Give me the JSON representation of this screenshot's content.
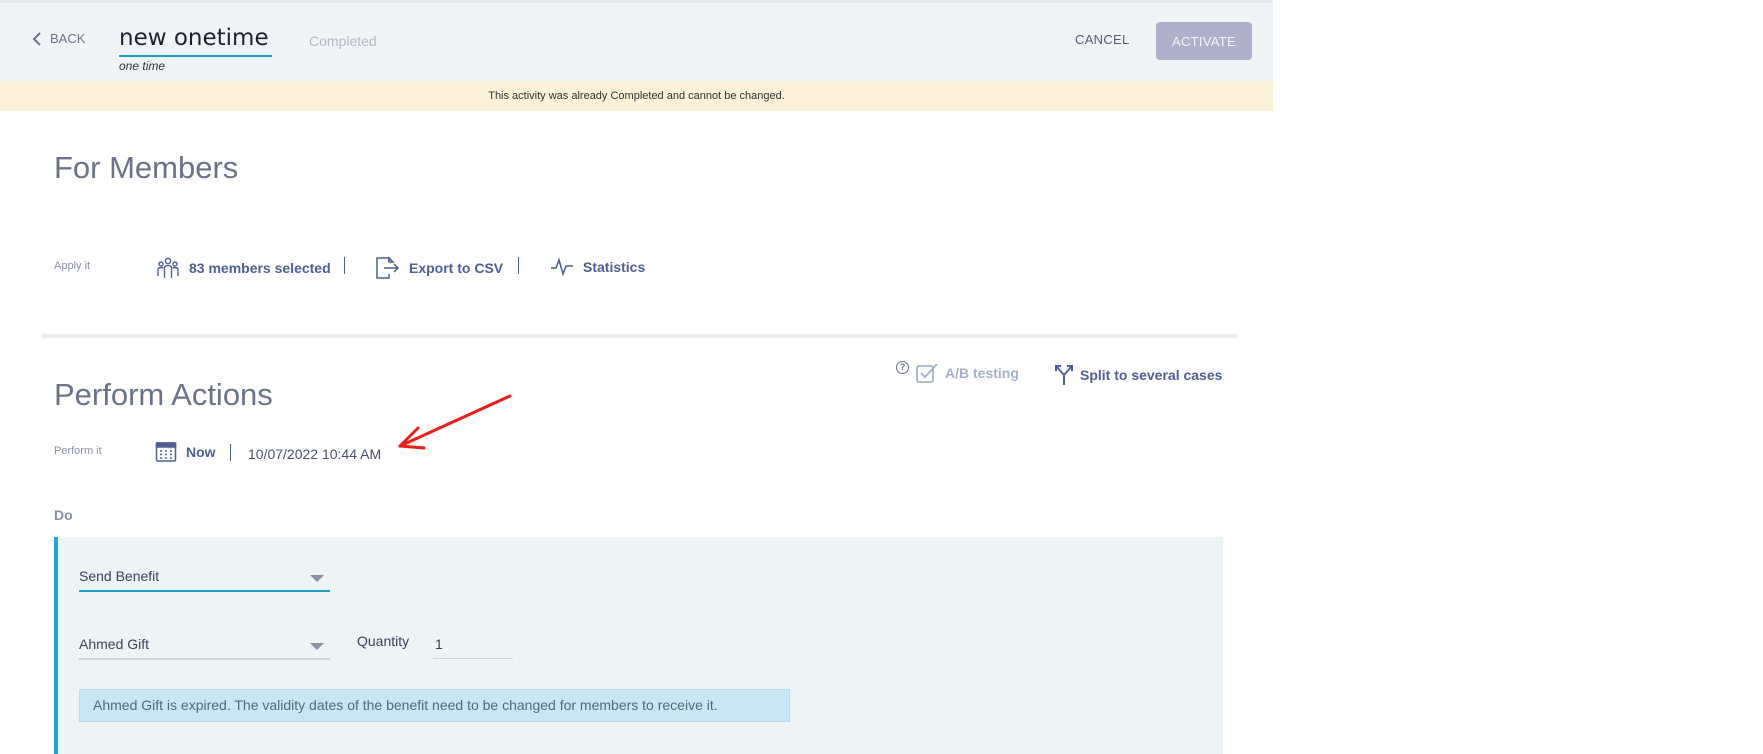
{
  "header": {
    "back_label": "BACK",
    "title_value": "new onetime",
    "title_sub": "one time",
    "status": "Completed",
    "cancel_label": "CANCEL",
    "activate_label": "ACTIVATE"
  },
  "notice": "This activity was already Completed and cannot be changed.",
  "members": {
    "title": "For Members",
    "apply_label": "Apply it",
    "members_selected": "83 members selected",
    "export_label": "Export to CSV",
    "statistics_label": "Statistics"
  },
  "actions": {
    "title": "Perform Actions",
    "ab_testing_label": "A/B testing",
    "help_glyph": "?",
    "split_label": "Split to several cases",
    "perform_label": "Perform it",
    "now_label": "Now",
    "datetime": "10/07/2022 10:44 AM",
    "do_label": "Do",
    "action_type": "Send Benefit",
    "benefit": "Ahmed Gift",
    "quantity_label": "Quantity",
    "quantity_value": "1",
    "warning": "Ahmed Gift is expired. The validity dates of the benefit need to be changed for members to receive it."
  },
  "colors": {
    "accent": "#1e9ec7",
    "link": "#4f5f94",
    "notice_bg": "#fbf0d8",
    "activate_bg": "#aeb1c9",
    "annotation_arrow": "#e8201c"
  },
  "icons": {
    "back": "chevron-left-icon",
    "members": "people-icon",
    "export": "export-file-icon",
    "statistics": "pulse-chart-icon",
    "ab": "checkbox-icon",
    "split": "split-fork-icon",
    "calendar": "calendar-icon",
    "dropdown": "caret-down-icon"
  }
}
